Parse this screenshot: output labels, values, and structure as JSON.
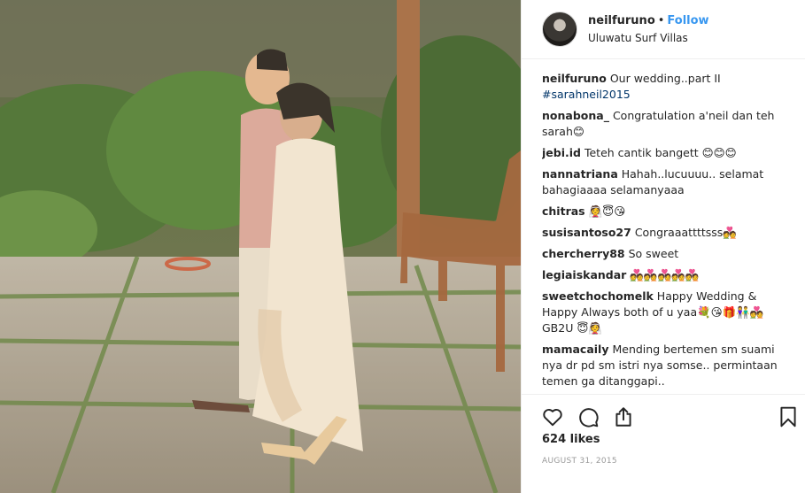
{
  "photo": {
    "alt_icon": "wedding-photo"
  },
  "header": {
    "username": "neilfuruno",
    "separator": "•",
    "follow_label": "Follow",
    "location": "Uluwatu Surf Villas"
  },
  "caption": {
    "username": "neilfuruno",
    "text": "Our wedding..part II",
    "hashtag": "#sarahneil2015"
  },
  "comments": [
    {
      "username": "nonabona_",
      "text": "Congratulation a'neil dan teh sarah😊"
    },
    {
      "username": "jebi.id",
      "text": "Teteh cantik bangett 😊😊😊"
    },
    {
      "username": "nannatriana",
      "text": "Hahah..lucuuuu.. selamat bahagiaaaa selamanyaaa"
    },
    {
      "username": "chitras",
      "text": "👰😇😘"
    },
    {
      "username": "susisantoso27",
      "text": "Congraaattttsss💑"
    },
    {
      "username": "chercherry88",
      "text": "So sweet"
    },
    {
      "username": "legiaiskandar",
      "text": "💑💑💑💑💑"
    },
    {
      "username": "sweetchochomelk",
      "text": "Happy Wedding & Happy Always both of u yaa💐😘🎁👫💑 GB2U 😇👰"
    },
    {
      "username": "mamacaily",
      "text": "Mending bertemen sm suami nya dr pd sm istri nya somse.. permintaan temen ga ditanggapi.."
    }
  ],
  "actions": {
    "like_icon": "heart-icon",
    "comment_icon": "comment-icon",
    "share_icon": "share-icon",
    "save_icon": "bookmark-icon"
  },
  "likes": "624 likes",
  "date": "AUGUST 31, 2015",
  "colors": {
    "link": "#3897f0",
    "text": "#262626",
    "muted": "#999999",
    "border": "#efefef"
  }
}
